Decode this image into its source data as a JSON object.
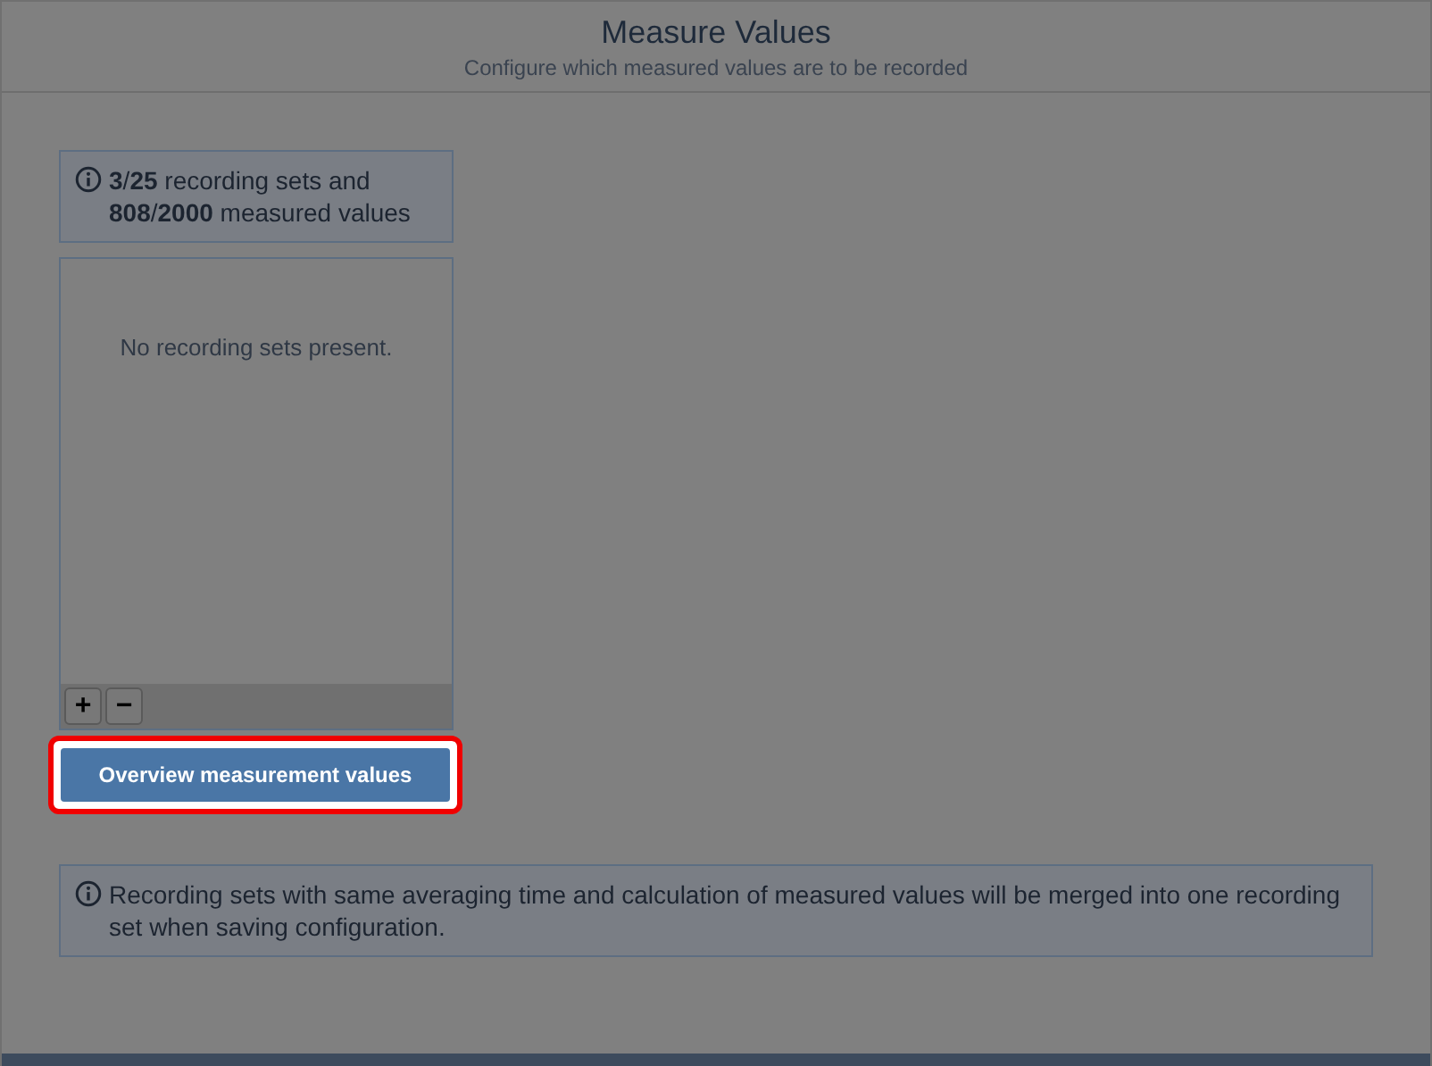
{
  "header": {
    "title": "Measure Values",
    "subtitle": "Configure which measured values are to be recorded"
  },
  "summary": {
    "text": "**3**/**25** recording sets and **808**/**2000** measured values"
  },
  "recording_sets": {
    "empty_message": "No recording sets present.",
    "add_button": "+",
    "remove_button": "−"
  },
  "overview_button": {
    "label": "Overview measurement values",
    "highlighted": true
  },
  "note": {
    "text": "Recording sets with same averaging time and calculation of measured values will be merged into one recording set when saving configuration."
  }
}
